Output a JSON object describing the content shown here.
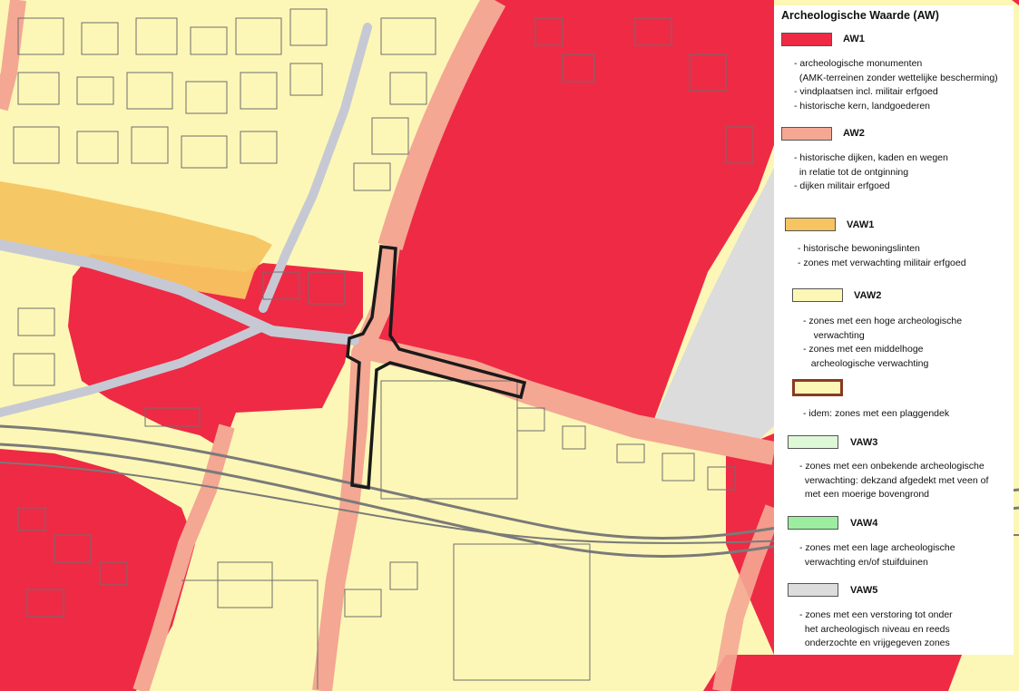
{
  "map": {
    "colors": {
      "base": "#fdf7b7",
      "aw1": "#ee2a45",
      "aw2": "#f4a793",
      "vaw1": "#f6c460",
      "vaw2": "#fdf7b7",
      "vaw5": "#dcdcdc",
      "road": "#c6c9d3",
      "outline": "#1a1a1a"
    },
    "features": [
      "aw1-zone",
      "aw2-historic-roads",
      "vaw1-ribbon",
      "vaw5-zone",
      "road-network",
      "plangebied-outline"
    ]
  },
  "legend": {
    "title": "Archeologische Waarde (AW)",
    "entries": [
      {
        "code": "AW1",
        "color": "#ee2a45",
        "lines": [
          "- archeologische monumenten",
          "  (AMK-terreinen zonder wettelijke bescherming)",
          "- vindplaatsen incl. militair erfgoed",
          "- historische kern, landgoederen"
        ]
      },
      {
        "code": "AW2",
        "color": "#f4a793",
        "lines": [
          "- historische dijken, kaden en wegen",
          "  in relatie tot de ontginning",
          "- dijken militair erfgoed"
        ]
      },
      {
        "code": "VAW1",
        "color": "#f6c460",
        "lines": [
          "- historische bewoningslinten",
          "- zones met verwachting militair erfgoed"
        ]
      },
      {
        "code": "VAW2",
        "color": "#fdf7b7",
        "lines": [
          "- zones met een hoge archeologische",
          "    verwachting",
          "- zones met een middelhoge",
          "   archeologische verwachting"
        ]
      },
      {
        "code": "",
        "color": "#fdf7b7",
        "border": "#8a3a22",
        "lines": [
          "- idem: zones met een plaggendek"
        ]
      },
      {
        "code": "VAW3",
        "color": "#def7d7",
        "lines": [
          "- zones met een onbekende archeologische",
          "  verwachting: dekzand afgedekt met veen of",
          "  met een moerige bovengrond"
        ]
      },
      {
        "code": "VAW4",
        "color": "#9ceda0",
        "lines": [
          "- zones met een lage archeologische",
          "  verwachting en/of stuifduinen"
        ]
      },
      {
        "code": "VAW5",
        "color": "#dcdcdc",
        "lines": [
          "- zones met een verstoring tot onder",
          "  het archeologisch niveau en reeds",
          "  onderzochte en vrijgegeven zones"
        ]
      }
    ]
  }
}
